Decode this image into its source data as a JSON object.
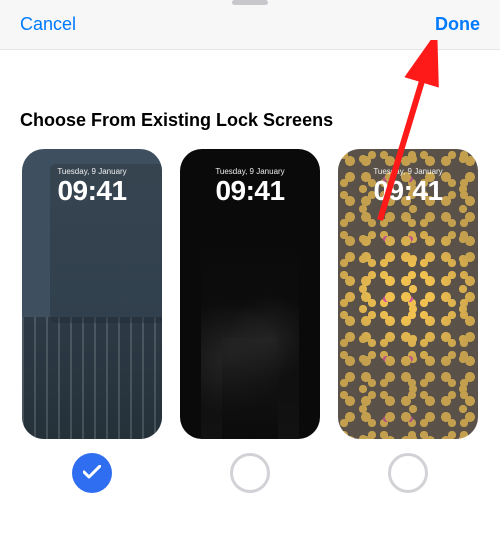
{
  "header": {
    "cancel_label": "Cancel",
    "done_label": "Done"
  },
  "section": {
    "title": "Choose From Existing Lock Screens"
  },
  "screens": [
    {
      "date": "Tuesday, 9 January",
      "time": "09:41",
      "selected": true
    },
    {
      "date": "Tuesday, 9 January",
      "time": "09:41",
      "selected": false
    },
    {
      "date": "Tuesday, 9 January",
      "time": "09:41",
      "selected": false
    }
  ],
  "colors": {
    "accent": "#007aff",
    "radio_selected": "#2f6ef0",
    "arrow": "#ff1a1a"
  }
}
